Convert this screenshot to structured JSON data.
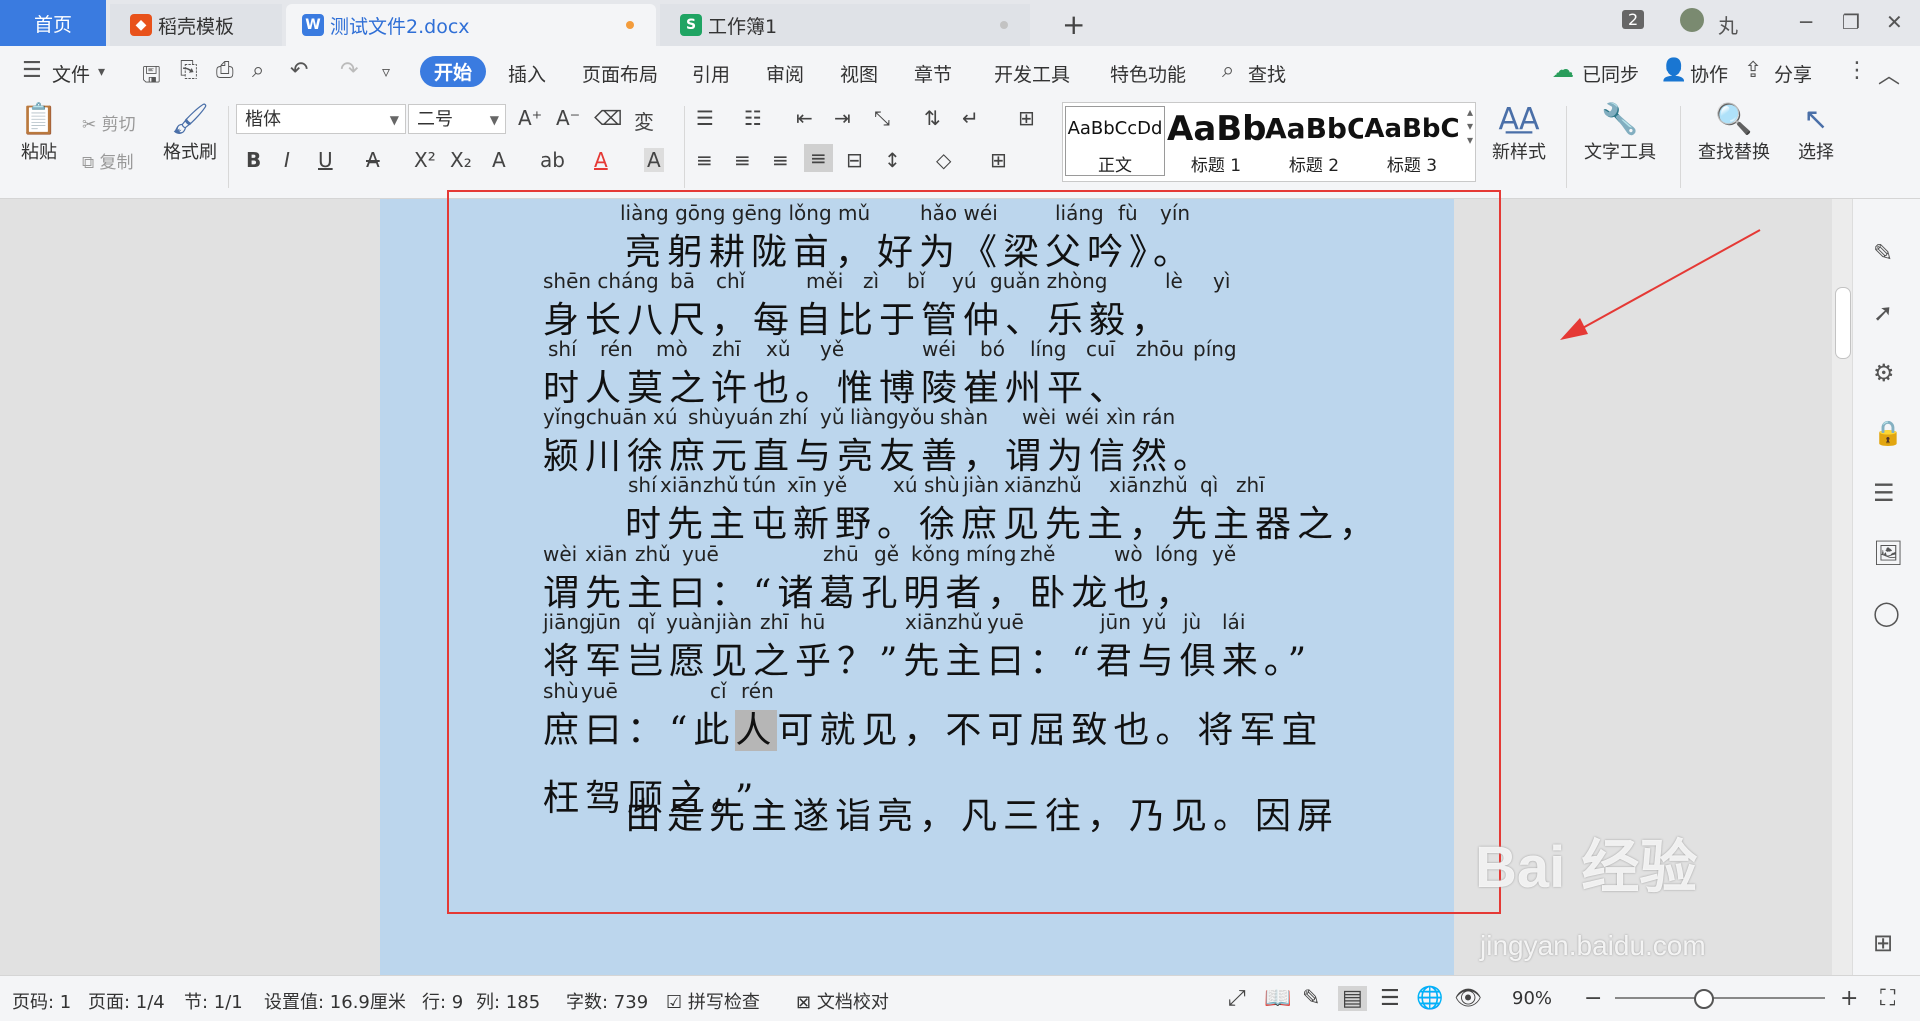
{
  "tabs": {
    "home": "首页",
    "template": "稻壳模板",
    "doc": "测试文件2.docx",
    "sheet": "工作簿1",
    "badge": "2",
    "user": "丸"
  },
  "menu": {
    "file": "文件",
    "items": [
      "开始",
      "插入",
      "页面布局",
      "引用",
      "审阅",
      "视图",
      "章节",
      "开发工具",
      "特色功能"
    ],
    "search": "查找",
    "synced": "已同步",
    "collab": "协作",
    "share": "分享"
  },
  "ribbon": {
    "paste": "粘贴",
    "cut": "剪切",
    "copy": "复制",
    "format_painter": "格式刷",
    "font": "楷体",
    "size": "二号",
    "styles": [
      {
        "preview": "AaBbCcDd",
        "name": "正文"
      },
      {
        "preview": "AaBb",
        "name": "标题 1"
      },
      {
        "preview": "AaBbC",
        "name": "标题 2"
      },
      {
        "preview": "AaBbC",
        "name": "标题 3"
      }
    ],
    "new_style": "新样式",
    "text_tools": "文字工具",
    "find_replace": "查找替换",
    "select": "选择"
  },
  "document": {
    "lines": [
      {
        "py": [
          [
            "liàng gōng gēng lǒng mǔ",
            620
          ],
          [
            "hǎo wéi",
            920
          ],
          [
            "liáng",
            1055
          ],
          [
            "fù",
            1118
          ],
          [
            "yín",
            1160
          ]
        ],
        "hz": "亮躬耕陇亩，好为《梁父吟》。",
        "hzx": 625
      },
      {
        "py": [
          [
            "shēn cháng",
            543
          ],
          [
            "bā",
            670
          ],
          [
            "chǐ",
            716
          ],
          [
            "měi",
            806
          ],
          [
            "zì",
            863
          ],
          [
            "bǐ",
            907
          ],
          [
            "yú",
            952
          ],
          [
            "guǎn zhòng",
            990
          ],
          [
            "lè",
            1165
          ],
          [
            "yì",
            1213
          ]
        ],
        "hz": "身长八尺，每自比于管仲、乐毅，",
        "hzx": 543
      },
      {
        "py": [
          [
            "shí",
            548
          ],
          [
            "rén",
            600
          ],
          [
            "mò",
            656
          ],
          [
            "zhī",
            712
          ],
          [
            "xǔ",
            766
          ],
          [
            "yě",
            820
          ],
          [
            "wéi",
            922
          ],
          [
            "bó",
            980
          ],
          [
            "líng",
            1030
          ],
          [
            "cuī",
            1086
          ],
          [
            "zhōu",
            1136
          ],
          [
            "píng",
            1193
          ]
        ],
        "hz": "时人莫之许也。惟博陵崔州平、",
        "hzx": 543
      },
      {
        "py": [
          [
            "yǐngchuān",
            543
          ],
          [
            "xú",
            653
          ],
          [
            "shù",
            688
          ],
          [
            "yuán",
            724
          ],
          [
            "zhí",
            779
          ],
          [
            "yǔ",
            820
          ],
          [
            "liàng",
            850
          ],
          [
            "yǒu",
            898
          ],
          [
            "shàn",
            940
          ],
          [
            "wèi",
            1022
          ],
          [
            "wéi",
            1065
          ],
          [
            "xìn",
            1106
          ],
          [
            "rán",
            1142
          ]
        ],
        "hz": "颍川徐庶元直与亮友善，谓为信然。",
        "hzx": 543
      },
      {
        "py": [
          [
            "shí",
            628
          ],
          [
            "xiān",
            660
          ],
          [
            "zhǔ",
            703
          ],
          [
            "tún",
            743
          ],
          [
            "xīn",
            787
          ],
          [
            "yě",
            823
          ],
          [
            "xú",
            893
          ],
          [
            "shù",
            924
          ],
          [
            "jiàn",
            963
          ],
          [
            "xiān",
            1004
          ],
          [
            "zhǔ",
            1046
          ],
          [
            "xiān",
            1109
          ],
          [
            "zhǔ",
            1152
          ],
          [
            "qì",
            1200
          ],
          [
            "zhī",
            1236
          ]
        ],
        "hz": "时先主屯新野。徐庶见先主，先主器之，",
        "hzx": 625
      },
      {
        "py": [
          [
            "wèi",
            543
          ],
          [
            "xiān",
            585
          ],
          [
            "zhǔ",
            635
          ],
          [
            "yuē",
            682
          ],
          [
            "zhū",
            823
          ],
          [
            "gě",
            874
          ],
          [
            "kǒng",
            911
          ],
          [
            "míng",
            966
          ],
          [
            "zhě",
            1020
          ],
          [
            "wò",
            1114
          ],
          [
            "lóng",
            1155
          ],
          [
            "yě",
            1212
          ]
        ],
        "hz": "谓先主曰：“诸葛孔明者，卧龙也，",
        "hzx": 543
      },
      {
        "py": [
          [
            "jiāng",
            543
          ],
          [
            "jūn",
            590
          ],
          [
            "qǐ",
            637
          ],
          [
            "yuàn",
            666
          ],
          [
            "jiàn",
            716
          ],
          [
            "zhī",
            760
          ],
          [
            "hū",
            800
          ],
          [
            "xiān",
            905
          ],
          [
            "zhǔ",
            947
          ],
          [
            "yuē",
            987
          ],
          [
            "jūn",
            1100
          ],
          [
            "yǔ",
            1142
          ],
          [
            "jù",
            1183
          ],
          [
            "lái",
            1222
          ]
        ],
        "hz": "将军岂愿见之乎？”先主曰：“君与俱来。”",
        "hzx": 543
      },
      {
        "py": [
          [
            "shù",
            543
          ],
          [
            "yuē",
            581
          ],
          [
            "cǐ",
            710
          ],
          [
            "rén",
            741
          ]
        ],
        "hz_parts": [
          "庶曰：“此",
          "人",
          "可就见，不可屈致也。将军宜"
        ],
        "hzx": 543
      },
      {
        "py": [],
        "hz": "枉驾顾之。”",
        "hzx": 543
      },
      {
        "py": [],
        "hz": "由是先主遂诣亮，凡三往，乃见。因屏",
        "hzx": 625
      }
    ]
  },
  "status": {
    "page_no": "页码: 1",
    "page": "页面: 1/4",
    "section": "节: 1/1",
    "setting": "设置值: 16.9厘米",
    "row": "行: 9",
    "col": "列: 185",
    "words": "字数: 739",
    "spell": "拼写检查",
    "proof": "文档校对",
    "zoom": "90%",
    "zoom_level": 0.4
  },
  "watermark": {
    "main": "Bai 经验",
    "sub": "jingyan.baidu.com"
  },
  "colors": {
    "accent": "#3a7be0",
    "page": "#bcd6ed",
    "selection_box": "#e53935"
  }
}
